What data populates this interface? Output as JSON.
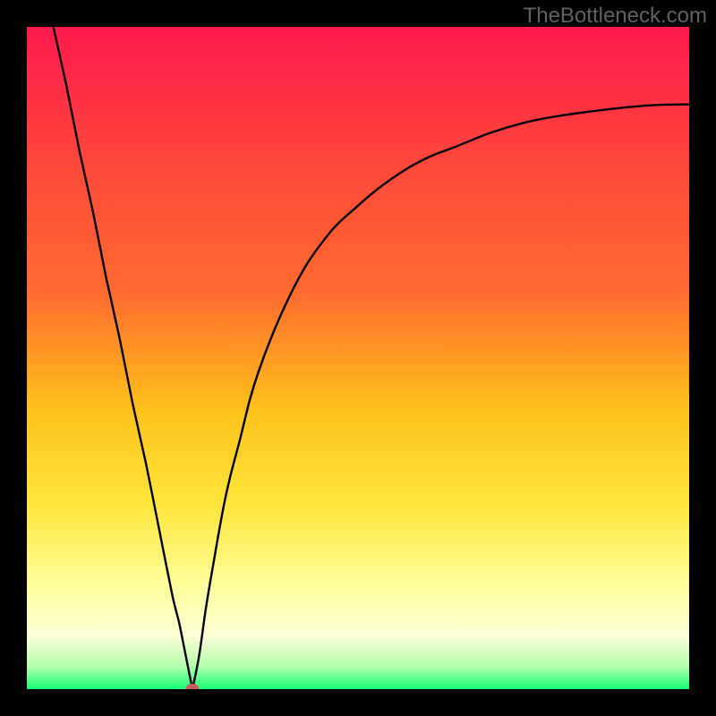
{
  "watermark": "TheBottleneck.com",
  "colors": {
    "gradient_top": "#ff1a4e",
    "gradient_mid1": "#ff6a2f",
    "gradient_mid2": "#ffc21a",
    "gradient_mid3": "#ffe63a",
    "gradient_mid4": "#ffffa0",
    "gradient_mid5": "#fcffd6",
    "gradient_bottom": "#14ff74",
    "curve": "#000000",
    "marker": "#cc5a5a",
    "frame": "#000000"
  },
  "chart_data": {
    "type": "line",
    "title": "",
    "xlabel": "",
    "ylabel": "",
    "xlim": [
      0,
      100
    ],
    "ylim": [
      0,
      100
    ],
    "grid": false,
    "legend": false,
    "minimum_x": 25,
    "series": [
      {
        "name": "curve",
        "x": [
          4,
          6,
          8,
          10,
          12,
          14,
          16,
          18,
          20,
          22,
          23,
          24,
          25,
          26,
          27,
          28,
          30,
          32,
          35,
          40,
          45,
          50,
          55,
          60,
          65,
          70,
          75,
          80,
          85,
          90,
          95,
          100
        ],
        "y": [
          100,
          91,
          81,
          72,
          62,
          53,
          43,
          34,
          24,
          14,
          10,
          5,
          0,
          5,
          12,
          18,
          29,
          37,
          48,
          60,
          68,
          73,
          77,
          80,
          82,
          84,
          85.5,
          86.5,
          87.2,
          87.8,
          88.2,
          88.3
        ]
      }
    ],
    "markers": [
      {
        "x": 25,
        "y": 0,
        "shape": "rounded-rect",
        "w": 2.0,
        "h": 1.6
      }
    ]
  }
}
